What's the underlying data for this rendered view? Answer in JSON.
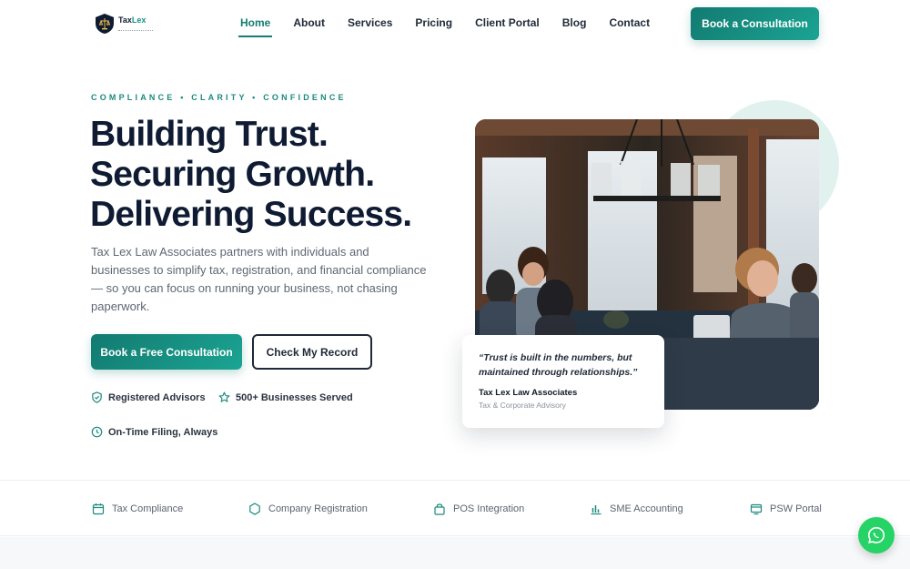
{
  "brand": {
    "name_part1": "Tax",
    "name_part2": "Lex",
    "accent_color": "#149186",
    "dark_color": "#0e1b32"
  },
  "nav": {
    "items": [
      {
        "label": "Home",
        "active": true
      },
      {
        "label": "About"
      },
      {
        "label": "Services"
      },
      {
        "label": "Pricing"
      },
      {
        "label": "Client Portal"
      },
      {
        "label": "Blog"
      },
      {
        "label": "Contact"
      }
    ],
    "cta_label": "Book a Consultation"
  },
  "hero": {
    "tagline": "COMPLIANCE • CLARITY • CONFIDENCE",
    "headline": [
      "Building Trust.",
      "Securing Growth.",
      "Delivering Success."
    ],
    "description": "Tax Lex Law Associates partners with individuals and businesses to simplify tax, registration, and financial compliance — so you can focus on running your business, not chasing paperwork.",
    "primary_button": "Book a Free Consultation",
    "secondary_button": "Check My Record",
    "features": [
      {
        "label": "Registered Advisors",
        "icon": "shield-check-icon"
      },
      {
        "label": "500+ Businesses Served",
        "icon": "star-icon"
      },
      {
        "label": "On-Time Filing, Always",
        "icon": "clock-icon"
      }
    ]
  },
  "quote": {
    "text": "“Trust is built in the numbers, but maintained through relationships.”",
    "author": "Tax Lex Law Associates",
    "role": "Tax & Corporate Advisory"
  },
  "services": [
    {
      "label": "Tax Compliance",
      "icon": "calendar-icon"
    },
    {
      "label": "Company Registration",
      "icon": "hexagon-icon"
    },
    {
      "label": "POS Integration",
      "icon": "shopping-bag-icon"
    },
    {
      "label": "SME Accounting",
      "icon": "bar-chart-icon"
    },
    {
      "label": "PSW Portal",
      "icon": "monitor-icon"
    }
  ],
  "colors": {
    "primary": "#157d73",
    "primary_light": "#1ba493",
    "whatsapp": "#25d366",
    "deco": "#e0f1ee"
  }
}
